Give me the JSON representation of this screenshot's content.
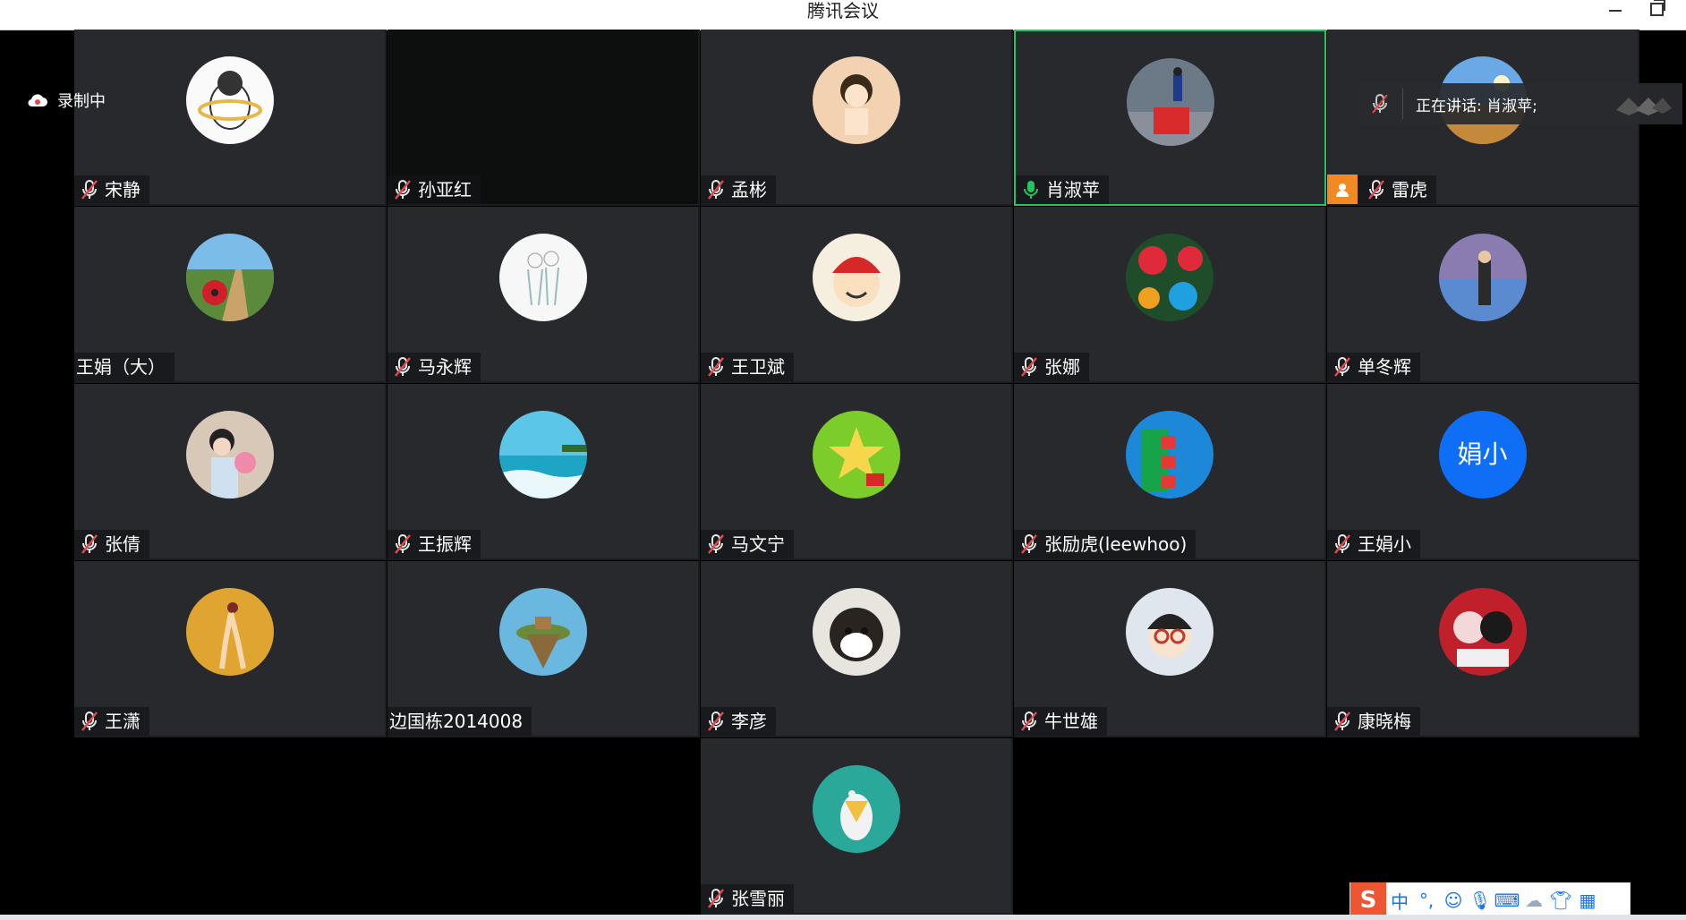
{
  "window": {
    "title": "腾讯会议"
  },
  "recording": {
    "label": "录制中"
  },
  "speaking": {
    "label": "正在讲话: 肖淑苹;"
  },
  "participants": [
    {
      "name": "宋静",
      "muted": true,
      "avatar": "cat-hula-hoop"
    },
    {
      "name": "孙亚红",
      "muted": true,
      "avatar": "none"
    },
    {
      "name": "孟彬",
      "muted": true,
      "avatar": "girl-cartoon"
    },
    {
      "name": "肖淑苹",
      "muted": false,
      "speaking": true,
      "avatar": "woman-flag"
    },
    {
      "name": "雷虎",
      "muted": true,
      "avatar": "sky-field",
      "host": true
    },
    {
      "name": "王娟（大）",
      "muted": null,
      "avatar": "red-flower-road"
    },
    {
      "name": "马永辉",
      "muted": true,
      "avatar": "couple-sketch"
    },
    {
      "name": "王卫斌",
      "muted": true,
      "avatar": "cartoon-boy-red-hat"
    },
    {
      "name": "张娜",
      "muted": true,
      "avatar": "poppies"
    },
    {
      "name": "单冬辉",
      "muted": true,
      "avatar": "person-purple"
    },
    {
      "name": "张倩",
      "muted": true,
      "avatar": "woman-roses"
    },
    {
      "name": "王振辉",
      "muted": true,
      "avatar": "ocean"
    },
    {
      "name": "马文宁",
      "muted": true,
      "avatar": "green-star"
    },
    {
      "name": "张励虎(leewhoo)",
      "muted": true,
      "avatar": "computer-screen"
    },
    {
      "name": "王娟小",
      "muted": true,
      "avatar": "initials",
      "initials": "娟小"
    },
    {
      "name": "王潇",
      "muted": true,
      "avatar": "dancer-yellow"
    },
    {
      "name": "边国栋2014008",
      "muted": null,
      "avatar": "floating-island"
    },
    {
      "name": "李彦",
      "muted": true,
      "avatar": "shiba-dog"
    },
    {
      "name": "牛世雄",
      "muted": true,
      "avatar": "boy-glasses"
    },
    {
      "name": "康晓梅",
      "muted": true,
      "avatar": "red-pattern"
    },
    {
      "name": "张雪丽",
      "muted": true,
      "avatar": "mouse-cheese"
    }
  ],
  "ime": {
    "brand": "S",
    "mode": "中",
    "punct": "°,"
  },
  "colors": {
    "tile_bg": "#27292d",
    "active_border": "#22c55e",
    "muted_red": "#e5484d",
    "unmuted_green": "#22c55e",
    "host_orange": "#f08a24",
    "initials_blue": "#0e6ef5"
  }
}
